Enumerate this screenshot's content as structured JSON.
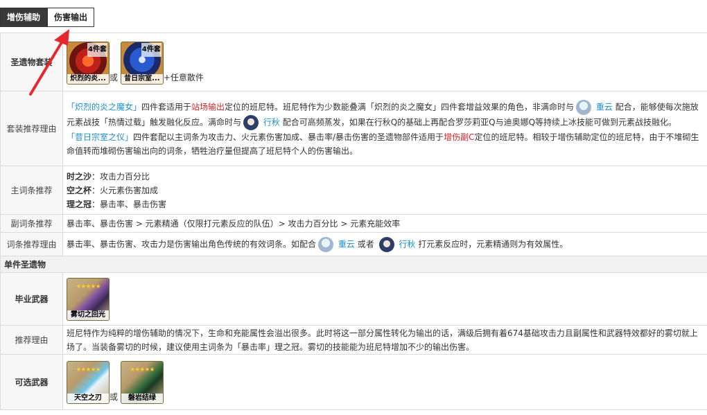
{
  "tabs": [
    "增伤辅助",
    "伤害输出"
  ],
  "labels": {
    "artifact_set": "圣遗物套装",
    "set_reason": "套装推荐理由",
    "main_stat": "主词条推荐",
    "sub_stat": "副词条推荐",
    "stat_reason": "词条推荐理由",
    "single_artifact": "单件圣遗物",
    "best_weapon": "毕业武器",
    "recommend_reason": "推荐理由",
    "alt_weapons": "可选武器"
  },
  "artifacts": {
    "set1_badge": "4件套",
    "set1_name": "炽烈的炎...",
    "set2_badge": "4件套",
    "set2_name": "昔日宗室...",
    "or": "或",
    "plus": "+任意散件"
  },
  "set_reason": {
    "p1_a": "「炽烈的炎之魔女」",
    "p1_b": "四件套适用于",
    "p1_c": "站场输出",
    "p1_d": "定位的班尼特。班尼特作为少数能叠满「炽烈的炎之魔女」四件套增益效果的角色，非满命时与",
    "chongyun": "重云",
    "p1_e": "配合，能够使每次施放元素战技「热情过载」触发融化反应。满命时与",
    "xingqiu": "行秋",
    "p1_f": "配合可高频蒸发，如果在行秋Q的基础上再配合罗莎莉亚Q与迪奥娜Q等持续上冰技能可做到元素战技融化。",
    "p2_a": "「昔日宗室之仪」",
    "p2_b": "四件套配以主词条为攻击力、火元素伤害加成、暴击率/暴击伤害的圣遗物部件适用于",
    "p2_c": "增伤副C",
    "p2_d": "定位的班尼特。相较于增伤辅助定位的班尼特，由于不堆砌生命值转而堆砌伤害输出向的词条，牺牲治疗量但提高了班尼特个人的伤害输出。"
  },
  "main_stats": [
    {
      "slot": "时之沙",
      "sep": "：",
      "value": "攻击力百分比"
    },
    {
      "slot": "空之杯",
      "sep": "：",
      "value": "火元素伤害加成"
    },
    {
      "slot": "理之冠",
      "sep": "：",
      "value": "暴击率、暴击伤害"
    }
  ],
  "sub_stats": "暴击率、暴击伤害 > 元素精通（仅限打元素反应的队伍）> 攻击力百分比 > 元素充能效率",
  "stat_reason": {
    "a": "暴击率、暴击伤害、攻击力是伤害输出角色传统的有效词条。如配合",
    "chongyun": "重云",
    "b": "或者",
    "xingqiu": "行秋",
    "c": "打元素反应时，元素精通则为有效属性。"
  },
  "best_weapon": {
    "stars": "★★★★★",
    "name": "雾切之回光"
  },
  "recommend_reason": "班尼特作为纯粹的增伤辅助的情况下，生命和充能属性会溢出很多。此时将这一部分属性转化为输出的话，满级后拥有着674基础攻击力且副属性和武器特效都好的雾切就上场了。当装备雾切的时候，建议使用主词条为「暴击率」理之冠。雾切的技能能为班尼特增加不少的输出伤害。",
  "alt_weapons": {
    "w1": {
      "stars": "★★★★★",
      "name": "天空之刃"
    },
    "or": "或",
    "w2": {
      "stars": "★★★★★",
      "name": "磐岩结绿"
    }
  },
  "colors": {
    "link": "#1b8fc7",
    "highlight": "#d8232a",
    "arrow": "#e8262e",
    "tab_active": "#3a3a3a"
  },
  "icons": [
    "crimson-witch-flower-icon",
    "noblesse-oblige-flower-icon",
    "chongyun-avatar-icon",
    "xingqiu-avatar-icon",
    "mistsplitter-sword-icon",
    "skyward-blade-icon",
    "primordial-jade-cutter-icon",
    "red-arrow-annotation"
  ]
}
